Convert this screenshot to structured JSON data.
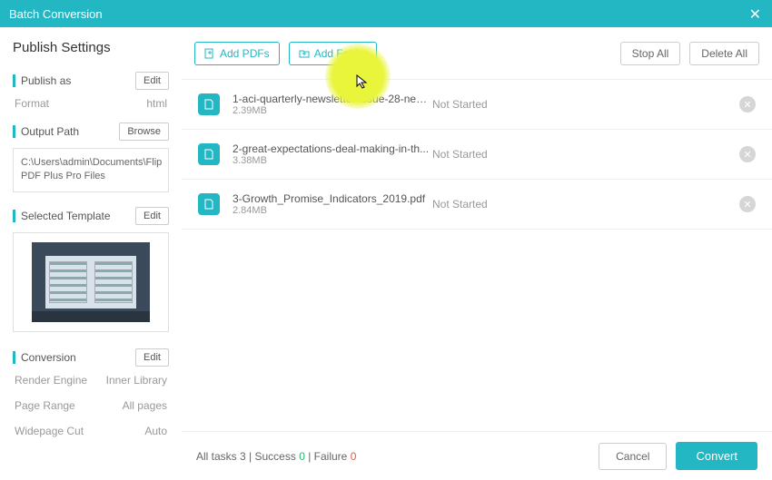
{
  "window": {
    "title": "Batch Conversion"
  },
  "sidebar": {
    "heading": "Publish Settings",
    "publish_as": {
      "label": "Publish as",
      "edit": "Edit",
      "format_key": "Format",
      "format_val": "html"
    },
    "output_path": {
      "label": "Output Path",
      "browse": "Browse",
      "path": "C:\\Users\\admin\\Documents\\Flip PDF Plus Pro Files"
    },
    "template": {
      "label": "Selected Template",
      "edit": "Edit"
    },
    "conversion": {
      "label": "Conversion",
      "edit": "Edit",
      "rows": [
        {
          "k": "Render Engine",
          "v": "Inner Library"
        },
        {
          "k": "Page Range",
          "v": "All pages"
        },
        {
          "k": "Widepage Cut",
          "v": "Auto"
        }
      ]
    }
  },
  "toolbar": {
    "add_pdfs": "Add PDFs",
    "add_folder": "Add Folder",
    "stop_all": "Stop All",
    "delete_all": "Delete All"
  },
  "files": [
    {
      "name": "1-aci-quarterly-newsletter-issue-28-new...",
      "size": "2.39MB",
      "status": "Not Started"
    },
    {
      "name": "2-great-expectations-deal-making-in-th...",
      "size": "3.38MB",
      "status": "Not Started"
    },
    {
      "name": "3-Growth_Promise_Indicators_2019.pdf",
      "size": "2.84MB",
      "status": "Not Started"
    }
  ],
  "footer": {
    "all_tasks_label": "All tasks ",
    "all_tasks_count": "3",
    "success_label": " | Success ",
    "success_count": "0",
    "failure_label": " | Failure ",
    "failure_count": "0",
    "cancel": "Cancel",
    "convert": "Convert"
  }
}
